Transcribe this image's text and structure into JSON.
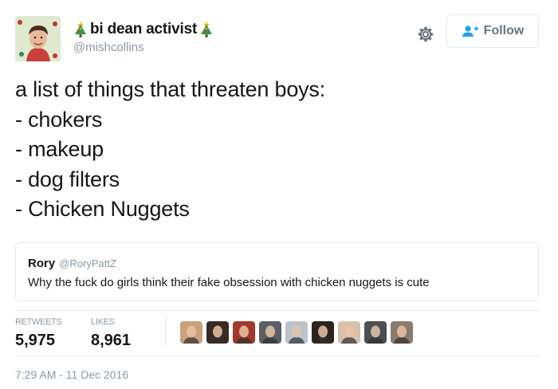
{
  "author": {
    "display_name": "bi dean activist",
    "handle": "@mishcollins",
    "avatar_icon": "profile-photo"
  },
  "header": {
    "settings_icon": "gear-icon",
    "follow_label": "Follow"
  },
  "tweet": {
    "lines": [
      "a list of things that threaten boys:",
      "- chokers",
      "- makeup",
      "- dog filters",
      "- Chicken Nuggets"
    ]
  },
  "quoted_tweet": {
    "name": "Rory",
    "handle": "@RoryPattZ",
    "text": "Why the fuck do girls think their fake obsession with chicken nuggets is cute"
  },
  "stats": {
    "retweets_label": "RETWEETS",
    "retweets_value": "5,975",
    "likes_label": "LIKES",
    "likes_value": "8,961"
  },
  "likers": [
    {
      "icon": "liker-avatar-1",
      "color": "#c9a27a"
    },
    {
      "icon": "liker-avatar-2",
      "color": "#3a2a24"
    },
    {
      "icon": "liker-avatar-3",
      "color": "#a4382a"
    },
    {
      "icon": "liker-avatar-4",
      "color": "#5a5f66"
    },
    {
      "icon": "liker-avatar-5",
      "color": "#b9c4cc"
    },
    {
      "icon": "liker-avatar-6",
      "color": "#2b241e"
    },
    {
      "icon": "liker-avatar-7",
      "color": "#d9c0a8"
    },
    {
      "icon": "liker-avatar-8",
      "color": "#4a4f55"
    },
    {
      "icon": "liker-avatar-9",
      "color": "#8c7a6c"
    }
  ],
  "timestamp": "7:29 AM - 11 Dec 2016",
  "colors": {
    "text": "#14171a",
    "secondary": "#8899a6",
    "border": "#e1e8ed",
    "accent": "#1da1f2"
  }
}
